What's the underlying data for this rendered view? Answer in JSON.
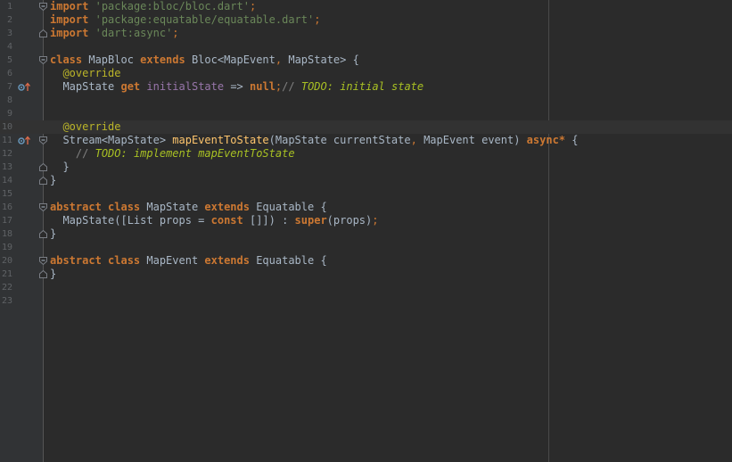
{
  "editor": {
    "lines": [
      {
        "n": "1",
        "fold": "open",
        "marker": "",
        "tokens": [
          [
            "kw",
            "import"
          ],
          [
            "plain",
            " "
          ],
          [
            "str",
            "'package:bloc/bloc.dart'"
          ],
          [
            "punc",
            ";"
          ]
        ]
      },
      {
        "n": "2",
        "fold": "",
        "marker": "",
        "tokens": [
          [
            "kw",
            "import"
          ],
          [
            "plain",
            " "
          ],
          [
            "str",
            "'package:equatable/equatable.dart'"
          ],
          [
            "punc",
            ";"
          ]
        ]
      },
      {
        "n": "3",
        "fold": "close",
        "marker": "",
        "tokens": [
          [
            "kw",
            "import"
          ],
          [
            "plain",
            " "
          ],
          [
            "str",
            "'dart:async'"
          ],
          [
            "punc",
            ";"
          ]
        ]
      },
      {
        "n": "4",
        "fold": "",
        "marker": "",
        "tokens": []
      },
      {
        "n": "5",
        "fold": "open",
        "marker": "",
        "tokens": [
          [
            "kw",
            "class"
          ],
          [
            "plain",
            " MapBloc "
          ],
          [
            "kw",
            "extends"
          ],
          [
            "plain",
            " Bloc<MapEvent"
          ],
          [
            "punc",
            ","
          ],
          [
            "plain",
            " MapState> {"
          ]
        ]
      },
      {
        "n": "6",
        "fold": "",
        "marker": "",
        "tokens": [
          [
            "plain",
            "  "
          ],
          [
            "ann",
            "@override"
          ]
        ]
      },
      {
        "n": "7",
        "fold": "",
        "marker": "override",
        "tokens": [
          [
            "plain",
            "  MapState "
          ],
          [
            "kw",
            "get"
          ],
          [
            "plain",
            " "
          ],
          [
            "fld",
            "initialState"
          ],
          [
            "plain",
            " => "
          ],
          [
            "kw",
            "null"
          ],
          [
            "punc",
            ";"
          ],
          [
            "cmt",
            "// "
          ],
          [
            "todo",
            "TODO: initial state"
          ]
        ]
      },
      {
        "n": "8",
        "fold": "",
        "marker": "",
        "tokens": []
      },
      {
        "n": "9",
        "fold": "",
        "marker": "",
        "tokens": []
      },
      {
        "n": "10",
        "fold": "",
        "marker": "",
        "tokens": [
          [
            "plain",
            "  "
          ],
          [
            "ann",
            "@override"
          ]
        ],
        "current": true
      },
      {
        "n": "11",
        "fold": "open",
        "marker": "override",
        "tokens": [
          [
            "plain",
            "  Stream<MapState> "
          ],
          [
            "fn",
            "mapEventToState"
          ],
          [
            "plain",
            "(MapState currentState"
          ],
          [
            "punc",
            ","
          ],
          [
            "plain",
            " MapEvent event) "
          ],
          [
            "kw",
            "async*"
          ],
          [
            "plain",
            " {"
          ]
        ]
      },
      {
        "n": "12",
        "fold": "",
        "marker": "",
        "tokens": [
          [
            "plain",
            "    "
          ],
          [
            "cmt",
            "// "
          ],
          [
            "todo",
            "TODO: implement mapEventToState"
          ]
        ]
      },
      {
        "n": "13",
        "fold": "close",
        "marker": "",
        "tokens": [
          [
            "plain",
            "  }"
          ]
        ]
      },
      {
        "n": "14",
        "fold": "close",
        "marker": "",
        "tokens": [
          [
            "plain",
            "}"
          ]
        ]
      },
      {
        "n": "15",
        "fold": "",
        "marker": "",
        "tokens": []
      },
      {
        "n": "16",
        "fold": "open",
        "marker": "",
        "tokens": [
          [
            "kw",
            "abstract class"
          ],
          [
            "plain",
            " MapState "
          ],
          [
            "kw",
            "extends"
          ],
          [
            "plain",
            " Equatable {"
          ]
        ]
      },
      {
        "n": "17",
        "fold": "",
        "marker": "",
        "tokens": [
          [
            "plain",
            "  MapState([List props = "
          ],
          [
            "kw",
            "const"
          ],
          [
            "plain",
            " []]) : "
          ],
          [
            "kw",
            "super"
          ],
          [
            "plain",
            "(props)"
          ],
          [
            "punc",
            ";"
          ]
        ]
      },
      {
        "n": "18",
        "fold": "close",
        "marker": "",
        "tokens": [
          [
            "plain",
            "}"
          ]
        ]
      },
      {
        "n": "19",
        "fold": "",
        "marker": "",
        "tokens": []
      },
      {
        "n": "20",
        "fold": "open",
        "marker": "",
        "tokens": [
          [
            "kw",
            "abstract class"
          ],
          [
            "plain",
            " MapEvent "
          ],
          [
            "kw",
            "extends"
          ],
          [
            "plain",
            " Equatable {"
          ]
        ]
      },
      {
        "n": "21",
        "fold": "close",
        "marker": "",
        "tokens": [
          [
            "plain",
            "}"
          ]
        ]
      },
      {
        "n": "22",
        "fold": "",
        "marker": "",
        "tokens": []
      },
      {
        "n": "23",
        "fold": "",
        "marker": "",
        "tokens": []
      }
    ]
  },
  "colors": {
    "background": "#2b2b2b",
    "gutter": "#313335",
    "keyword": "#cc7832",
    "string": "#6a8759",
    "annotation": "#bbb529",
    "field": "#9876aa",
    "function": "#ffc66d",
    "comment": "#808080",
    "todo": "#a8c023",
    "text": "#a9b7c6"
  }
}
